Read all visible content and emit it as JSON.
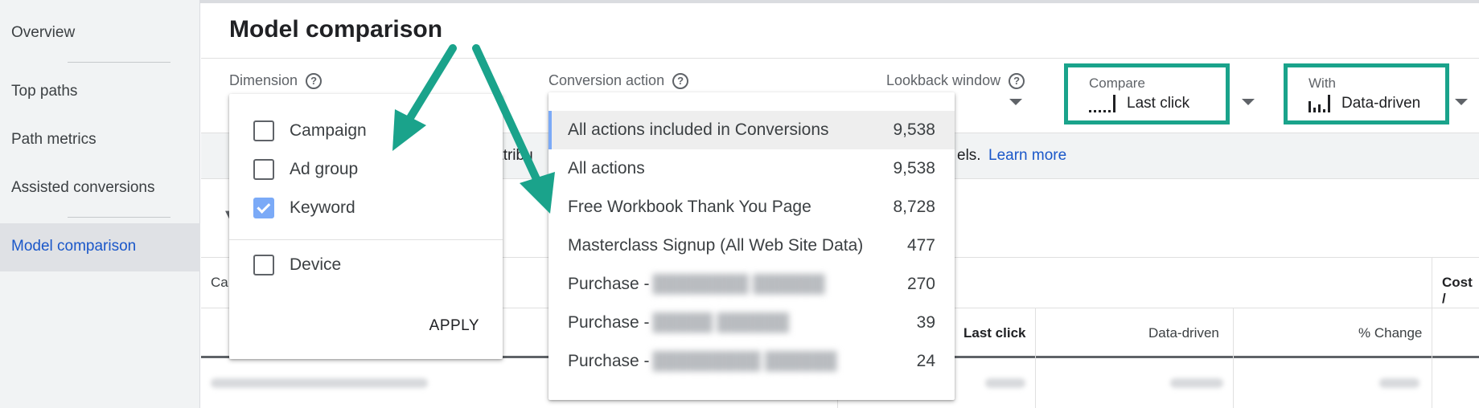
{
  "sidebar": {
    "items": [
      {
        "label": "Overview"
      },
      {
        "label": "Top paths"
      },
      {
        "label": "Path metrics"
      },
      {
        "label": "Assisted conversions"
      },
      {
        "label": "Model comparison"
      }
    ],
    "active_item": "Model comparison"
  },
  "header": {
    "title": "Model comparison"
  },
  "filters": {
    "dimension_label": "Dimension",
    "conversion_label": "Conversion action",
    "lookback_label": "Lookback window",
    "help_glyph": "?"
  },
  "compare": {
    "compare_label": "Compare",
    "compare_value": "Last click",
    "with_label": "With",
    "with_value": "Data-driven",
    "highlight_color": "#1aa38b"
  },
  "notice": {
    "fragment_left": "g attribu",
    "fragment_right": "els.",
    "learn_more": "Learn more"
  },
  "table": {
    "header_fragment_left": "Ca",
    "header_fragment_right": "Cost /",
    "col_last_click": "Last click",
    "col_data_driven": "Data-driven",
    "col_change": "% Change",
    "col_sort_glyph": "↓"
  },
  "dimension_popup": {
    "options": [
      {
        "label": "Campaign",
        "checked": false
      },
      {
        "label": "Ad group",
        "checked": false
      },
      {
        "label": "Keyword",
        "checked": true
      },
      {
        "label": "Device",
        "checked": false
      }
    ],
    "apply_label": "APPLY"
  },
  "conversion_popup": {
    "items": [
      {
        "name": "All actions included in Conversions",
        "count": "9,538",
        "selected": true
      },
      {
        "name": "All actions",
        "count": "9,538"
      },
      {
        "name": "Free Workbook Thank You Page",
        "count": "8,728"
      },
      {
        "name": "Masterclass Signup (All Web Site Data)",
        "count": "477"
      },
      {
        "name": "Purchase -",
        "count": "270",
        "redacted": true
      },
      {
        "name": "Purchase -",
        "count": "39",
        "redacted": true
      },
      {
        "name": "Purchase -",
        "count": "24",
        "redacted": true
      }
    ],
    "accent_color": "#7baaf7"
  },
  "annotation": {
    "arrow_color": "#1aa38b"
  }
}
